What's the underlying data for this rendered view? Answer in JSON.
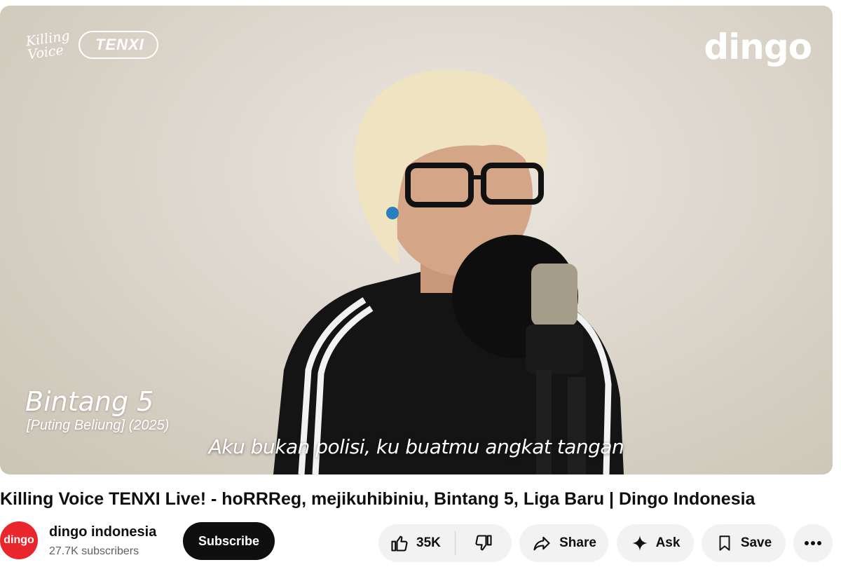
{
  "video": {
    "logo_script": "Killing Voice",
    "logo_badge": "TENXI",
    "brand_logo": "dingo",
    "song_title": "Bintang 5",
    "song_subtitle": "[Puting Beliung] (2025)",
    "caption": "Aku bukan polisi, ku buatmu angkat tangan"
  },
  "title": "Killing Voice TENXI Live! - hoRRReg, mejikuhibiniu, Bintang 5, Liga Baru | Dingo Indonesia",
  "channel": {
    "avatar_text": "dingo",
    "name": "dingo indonesia",
    "subscribers": "27.7K subscribers",
    "subscribe_label": "Subscribe"
  },
  "actions": {
    "likes": "35K",
    "share_label": "Share",
    "ask_label": "Ask",
    "save_label": "Save",
    "icons": [
      "thumbs-up-icon",
      "thumbs-down-icon",
      "share-icon",
      "sparkle-icon",
      "bookmark-icon",
      "more-icon"
    ]
  },
  "colors": {
    "brand_red": "#e8262c",
    "subscribe_bg": "#0f0f0f",
    "pill_bg": "#f2f2f2"
  }
}
